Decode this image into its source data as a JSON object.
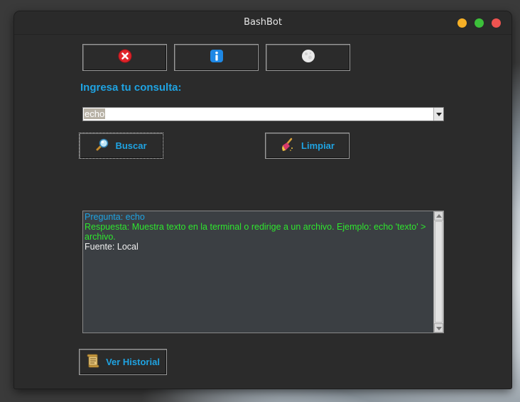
{
  "window": {
    "title": "BashBot",
    "controls": {
      "minimize_color": "#f6b026",
      "maximize_color": "#3cc03a",
      "close_color": "#ee5350"
    }
  },
  "toolbar": {
    "icons": [
      "close-circle-icon",
      "info-icon",
      "moon-icon"
    ]
  },
  "query": {
    "label": "Ingresa tu consulta:",
    "value": "echo"
  },
  "buttons": {
    "search": "Buscar",
    "clear": "Limpiar",
    "history": "Ver Historial"
  },
  "result": {
    "question": "Pregunta: echo",
    "answer": "Respuesta: Muestra texto en la terminal o redirige a un archivo. Ejemplo: echo 'texto' > archivo.",
    "source": "Fuente: Local"
  },
  "colors": {
    "accent": "#1fa3e2",
    "answer": "#2ee62e",
    "background": "#2b2b2b"
  }
}
